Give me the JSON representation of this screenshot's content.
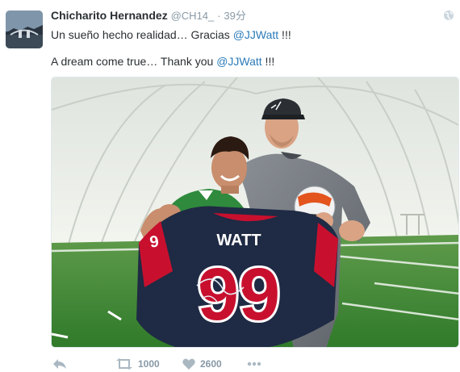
{
  "tweet": {
    "author_name": "Chicharito Hernandez",
    "handle": "@CH14_",
    "separator": "·",
    "time": "39分",
    "line1_text": "Un sueño hecho realidad… Gracias ",
    "line1_mention": "@JJWatt",
    "line1_suffix": " !!!",
    "line2_text": "A dream come true… Thank you ",
    "line2_mention": "@JJWatt",
    "line2_suffix": " !!!"
  },
  "photo": {
    "jersey_name": "WATT",
    "jersey_number": "99",
    "sleeve_number": "9"
  },
  "actions": {
    "retweet_count": "1000",
    "like_count": "2600"
  },
  "colors": {
    "link": "#2b7bb9",
    "muted": "#8899a6",
    "turf": "#3c8a32",
    "jersey_navy": "#1f2a44",
    "jersey_red": "#c8102e"
  },
  "icons": [
    "avatar",
    "globe-icon",
    "reply-icon",
    "retweet-icon",
    "heart-icon",
    "more-icon"
  ]
}
